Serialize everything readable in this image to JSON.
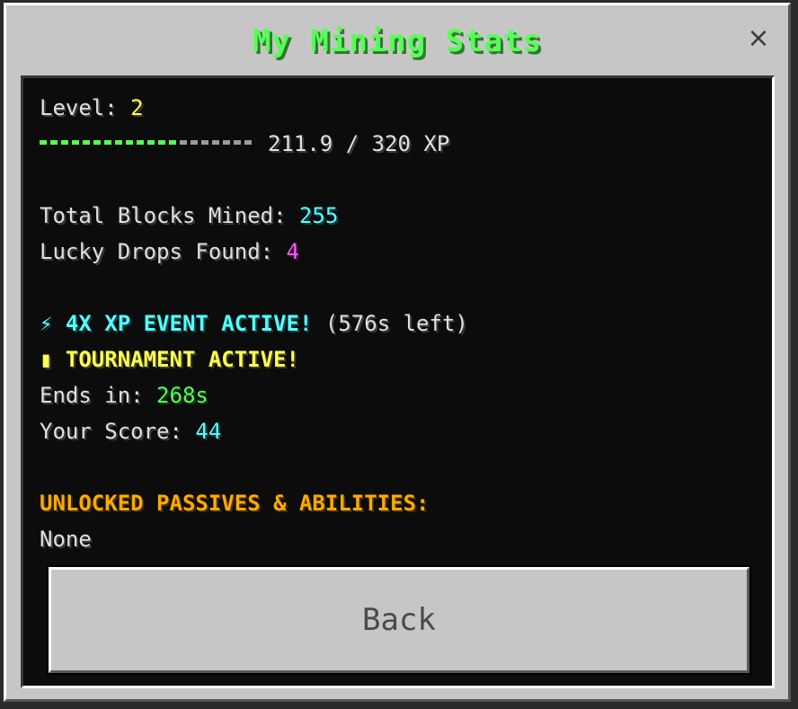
{
  "title": "My Mining Stats",
  "close_icon": "×",
  "stats": {
    "level_label": "Level: ",
    "level_value": "2",
    "xp_text": "211.9 / 320 XP",
    "xp_progress": 0.662,
    "blocks_label": "Total Blocks Mined: ",
    "blocks_value": "255",
    "lucky_label": "Lucky Drops Found: ",
    "lucky_value": "4"
  },
  "events": {
    "xp_event_icon": "⚡",
    "xp_event_text": "4X XP EVENT ACTIVE!",
    "xp_event_time": " (576s left)",
    "tournament_icon": "▮",
    "tournament_text": "TOURNAMENT ACTIVE!",
    "ends_label": "Ends in: ",
    "ends_value": "268s",
    "score_label": "Your Score: ",
    "score_value": "44"
  },
  "passives": {
    "heading": "UNLOCKED PASSIVES & ABILITIES:",
    "value": "None"
  },
  "back_label": "Back",
  "colors": {
    "title": "#55ff55",
    "yellow": "#ffff55",
    "aqua": "#55ffff",
    "magenta": "#ff55ff",
    "green": "#55ff55",
    "gold": "#ffaa00"
  }
}
